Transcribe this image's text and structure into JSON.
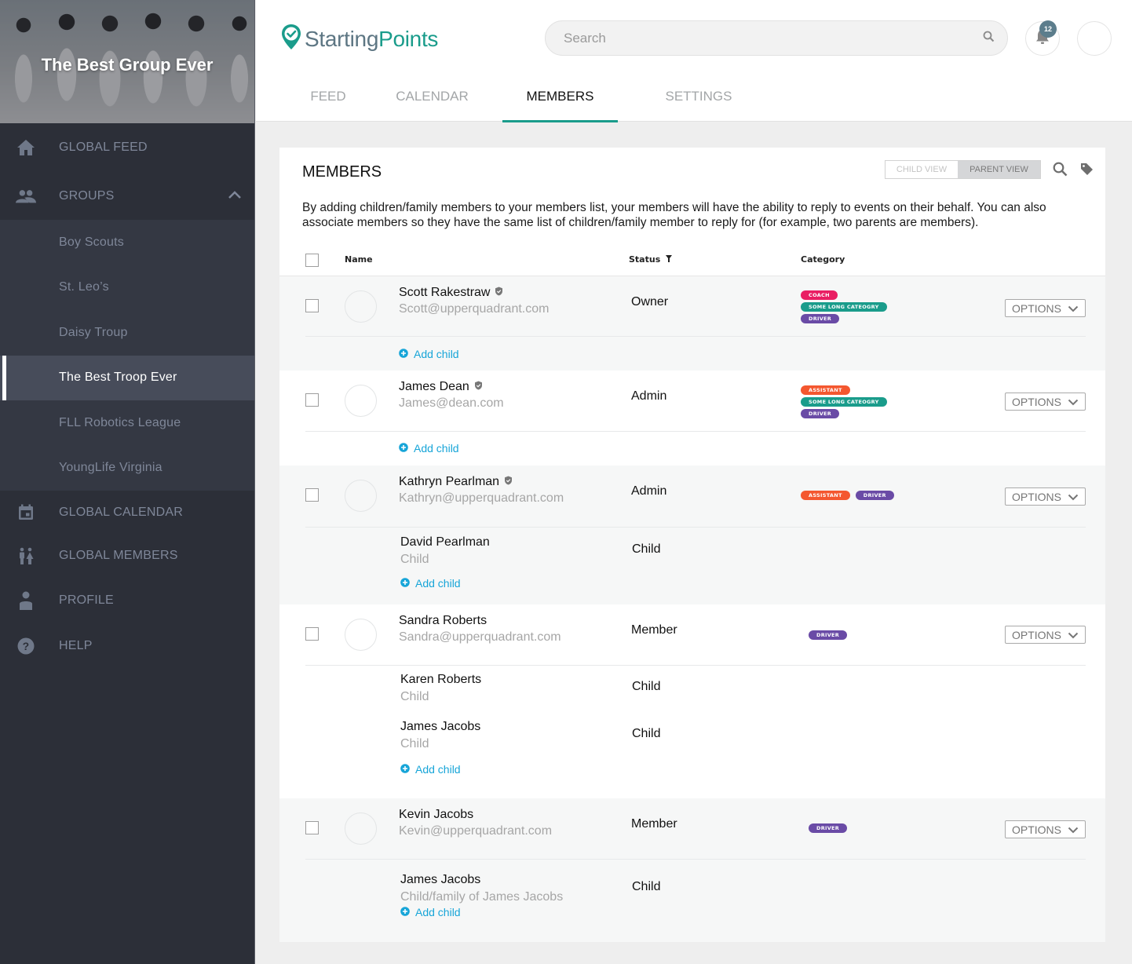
{
  "sidebar": {
    "group_title": "The Best Group Ever",
    "nav": {
      "global_feed": "GLOBAL FEED",
      "groups": "GROUPS",
      "global_calendar": "GLOBAL CALENDAR",
      "global_members": "GLOBAL MEMBERS",
      "profile": "PROFILE",
      "help": "HELP"
    },
    "groups": [
      {
        "label": "Boy Scouts",
        "active": false
      },
      {
        "label": "St. Leo’s",
        "active": false
      },
      {
        "label": "Daisy Troup",
        "active": false
      },
      {
        "label": "The Best Troop Ever",
        "active": true
      },
      {
        "label": "FLL Robotics League",
        "active": false
      },
      {
        "label": "YoungLife Virginia",
        "active": false
      }
    ]
  },
  "header": {
    "logo": {
      "part1": "Starting",
      "part2": "Points"
    },
    "search_placeholder": "Search",
    "notification_count": "12",
    "tabs": [
      {
        "label": "FEED",
        "active": false
      },
      {
        "label": "CALENDAR",
        "active": false
      },
      {
        "label": "MEMBERS",
        "active": true
      },
      {
        "label": "SETTINGS",
        "active": false
      }
    ]
  },
  "members_card": {
    "title": "MEMBERS",
    "view_toggle": {
      "child": "CHILD VIEW",
      "parent": "PARENT VIEW",
      "selected": "parent"
    },
    "description": "By adding children/family members to your members list, your members will have the ability to reply to events on their behalf. You can also associate members so they have the same list of children/family member to reply for (for example, two parents are members).",
    "columns": {
      "name": "Name",
      "status": "Status",
      "category": "Category"
    },
    "options_label": "OPTIONS",
    "add_child_label": "Add child",
    "members": [
      {
        "name": "Scott Rakestraw",
        "email": "Scott@upperquadrant.com",
        "status": "Owner",
        "verified": true,
        "tags": [
          {
            "label": "COACH",
            "color": "#e91e63"
          },
          {
            "label": "SOME LONG CATEOGRY",
            "color": "#1a9c8b"
          },
          {
            "label": "DRIVER",
            "color": "#6a4ba6"
          }
        ],
        "children": []
      },
      {
        "name": "James Dean",
        "email": "James@dean.com",
        "status": "Admin",
        "verified": true,
        "tags": [
          {
            "label": "ASSISTANT",
            "color": "#f4572f"
          },
          {
            "label": "SOME LONG CATEOGRY",
            "color": "#1a9c8b"
          },
          {
            "label": "DRIVER",
            "color": "#6a4ba6"
          }
        ],
        "children": []
      },
      {
        "name": "Kathryn Pearlman",
        "email": "Kathryn@upperquadrant.com",
        "status": "Admin",
        "verified": true,
        "tags": [
          {
            "label": "ASSISTANT",
            "color": "#f4572f"
          },
          {
            "label": "DRIVER",
            "color": "#6a4ba6"
          }
        ],
        "children": [
          {
            "name": "David Pearlman",
            "sub": "Child",
            "status": "Child"
          }
        ]
      },
      {
        "name": "Sandra Roberts",
        "email": "Sandra@upperquadrant.com",
        "status": "Member",
        "verified": false,
        "tags": [
          {
            "label": "DRIVER",
            "color": "#6a4ba6"
          }
        ],
        "children": [
          {
            "name": "Karen Roberts",
            "sub": "Child",
            "status": "Child"
          },
          {
            "name": "James Jacobs",
            "sub": "Child",
            "status": "Child"
          }
        ]
      },
      {
        "name": "Kevin Jacobs",
        "email": "Kevin@upperquadrant.com",
        "status": "Member",
        "verified": false,
        "tags": [
          {
            "label": "DRIVER",
            "color": "#6a4ba6"
          }
        ],
        "children": [
          {
            "name": "James Jacobs",
            "sub": "Child/family of James Jacobs",
            "status": "Child"
          }
        ]
      }
    ]
  },
  "colors": {
    "accent": "#1a9c8b",
    "link": "#17a5d8",
    "sidebar_bg": "#2c2f38",
    "badge": "#5c7d8c"
  }
}
